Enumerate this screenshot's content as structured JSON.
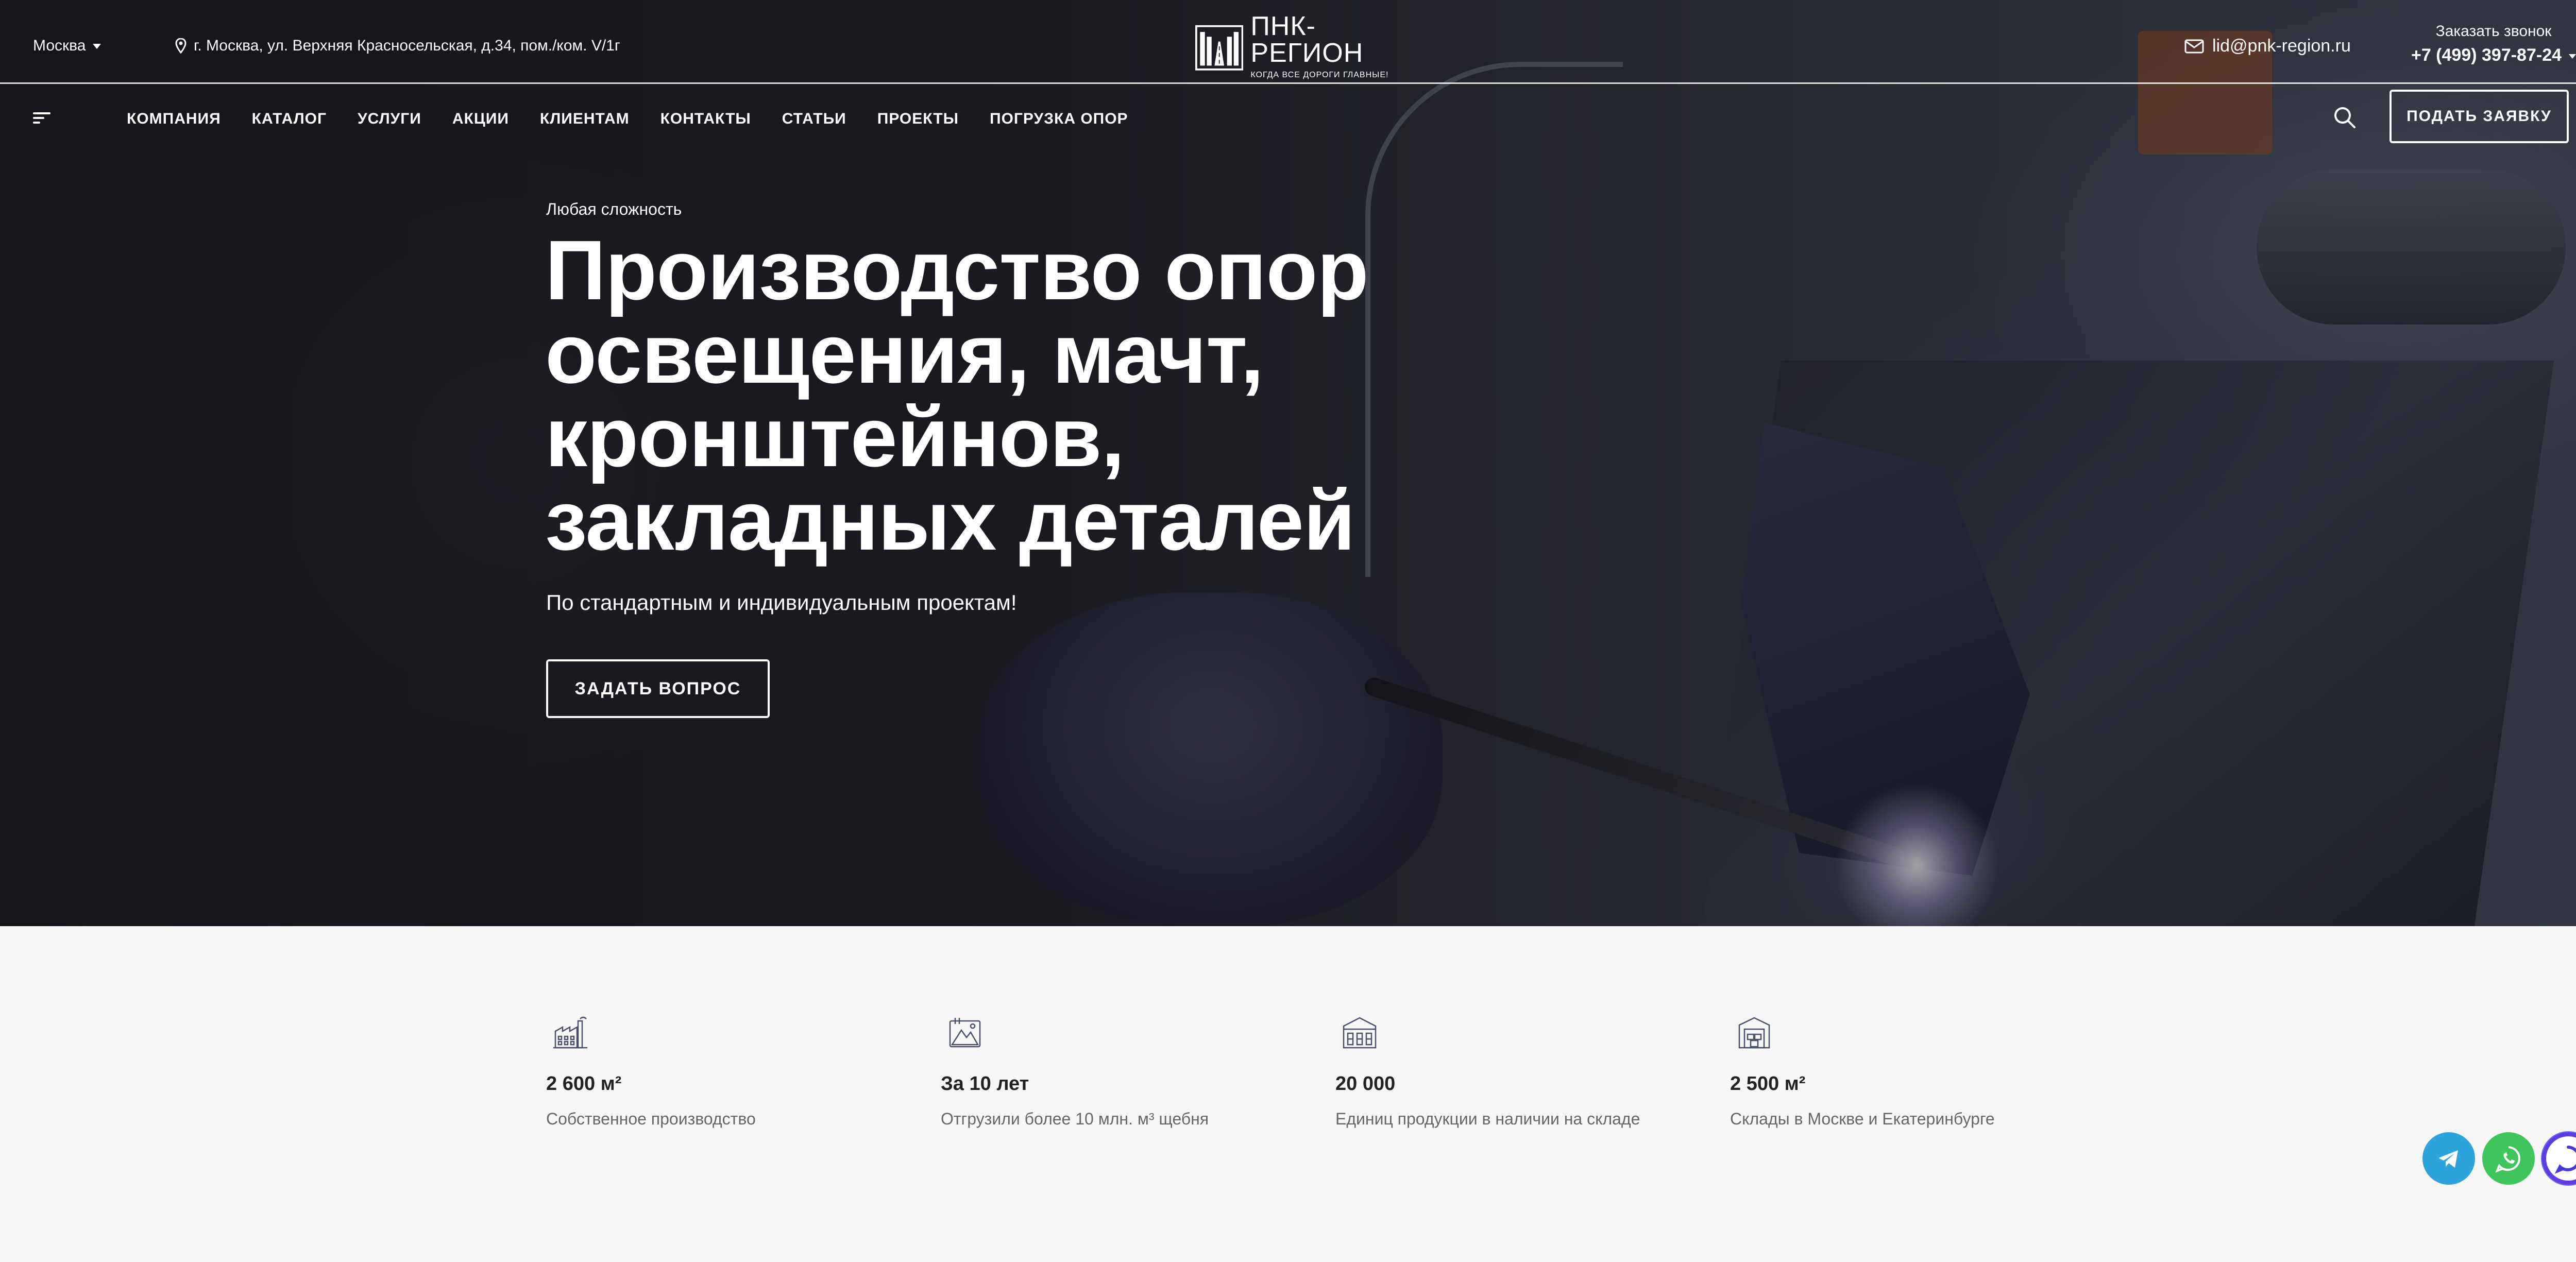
{
  "header": {
    "city": "Москва",
    "address": "г. Москва, ул. Верхняя Красносельская, д.34, пом./ком. V/1г",
    "logo_name": "ПНК-РЕГИОН",
    "logo_slogan": "КОГДА ВСЕ ДОРОГИ ГЛАВНЫЕ!",
    "email": "lid@pnk-region.ru",
    "callback_label": "Заказать звонок",
    "phone": "+7 (499) 397-87-24"
  },
  "nav": {
    "items": [
      "КОМПАНИЯ",
      "КАТАЛОГ",
      "УСЛУГИ",
      "АКЦИИ",
      "КЛИЕНТАМ",
      "КОНТАКТЫ",
      "СТАТЬИ",
      "ПРОЕКТЫ",
      "ПОГРУЗКА ОПОР"
    ],
    "apply_label": "ПОДАТЬ ЗАЯВКУ"
  },
  "hero": {
    "kicker": "Любая сложность",
    "headline_lines": [
      "Производство опор",
      "освещения, мачт,",
      "кронштейнов,",
      "закладных деталей"
    ],
    "subline": "По стандартным и индивидуальным проектам!",
    "cta": "ЗАДАТЬ ВОПРОС"
  },
  "stats": [
    {
      "icon": "factory-icon",
      "value": "2 600 м²",
      "label": "Собственное производство"
    },
    {
      "icon": "mountain-icon",
      "value": "За 10 лет",
      "label": "Отгрузили более 10 млн. м³ щебня"
    },
    {
      "icon": "warehouse-icon",
      "value": "20 000",
      "label": "Единиц продукции в наличии на складе"
    },
    {
      "icon": "storage-icon",
      "value": "2 500 м²",
      "label": "Склады в Москве и Екатеринбурге"
    }
  ],
  "messengers": [
    "telegram-icon",
    "whatsapp-icon",
    "chat-icon"
  ],
  "colors": {
    "telegram": "#2ea4dc",
    "whatsapp": "#3ec55c",
    "chat_ring": "#5b3de0",
    "stats_bg": "#f7f7f7",
    "icon_stroke": "#4a5068"
  }
}
